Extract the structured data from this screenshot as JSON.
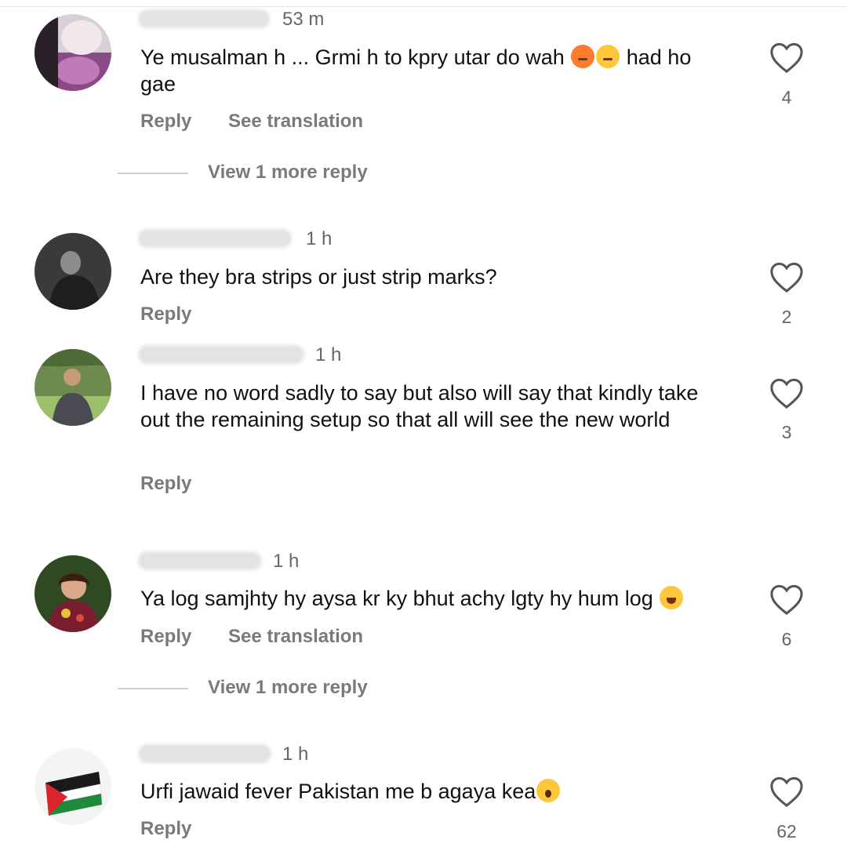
{
  "actions": {
    "reply": "Reply",
    "see_translation": "See translation"
  },
  "comments": [
    {
      "time": "53 m",
      "text_before": "Ye musalman h ... Grmi h to kpry utar do wah ",
      "text_after": " had ho gae",
      "likes": "4",
      "view_more": "View 1 more reply"
    },
    {
      "time": "1 h",
      "text": "Are they bra strips or just strip marks?",
      "likes": "2"
    },
    {
      "time": "1 h",
      "text": "I have no word sadly to say but also will say that kindly take out the remaining setup so that all will see the new world",
      "likes": "3"
    },
    {
      "time": "1 h",
      "text": "Ya log samjhty hy aysa kr ky bhut achy lgty hy hum  log ",
      "likes": "6",
      "view_more": "View 1 more reply"
    },
    {
      "time": "1 h",
      "text": "Urfi jawaid fever Pakistan me b agaya kea",
      "likes": "62"
    }
  ],
  "icons": {
    "like": "heart-outline-icon"
  }
}
